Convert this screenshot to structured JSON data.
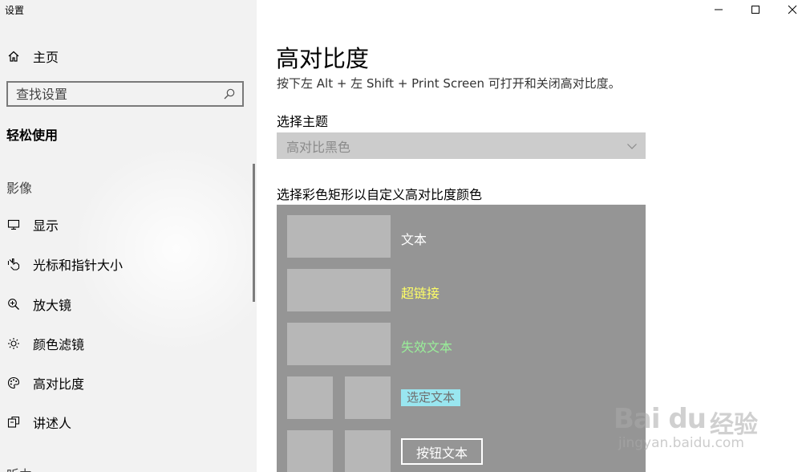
{
  "window": {
    "title": "设置",
    "controls": {
      "minimize": "minimize",
      "maximize": "maximize",
      "close": "close"
    }
  },
  "sidebar": {
    "home_label": "主页",
    "search_placeholder": "查找设置",
    "section_title": "轻松使用",
    "group_label": "影像",
    "items": [
      {
        "label": "显示",
        "icon": "monitor-icon"
      },
      {
        "label": "光标和指针大小",
        "icon": "pointer-icon"
      },
      {
        "label": "放大镜",
        "icon": "magnifier-icon"
      },
      {
        "label": "颜色滤镜",
        "icon": "sun-icon"
      },
      {
        "label": "高对比度",
        "icon": "palette-icon"
      },
      {
        "label": "讲述人",
        "icon": "narrator-icon"
      }
    ],
    "more_label": "听力"
  },
  "main": {
    "title": "高对比度",
    "hint": "按下左 Alt + 左 Shift + Print Screen 可打开和关闭高对比度。",
    "theme_label": "选择主题",
    "theme_selected": "高对比黑色",
    "color_label": "选择彩色矩形以自定义高对比度颜色",
    "swatches": {
      "text": "文本",
      "hyperlink": "超链接",
      "disabled_text": "失效文本",
      "selected_text": "选定文本",
      "button_text": "按钮文本"
    }
  },
  "colors": {
    "sidebar_bg": "#f2f2f2",
    "panel_bg": "#959595",
    "swatch_bg": "#b7b7b7",
    "hyperlink": "#ffff66",
    "disabled": "#99ee99",
    "selected_bg": "#99e6f0"
  },
  "watermark": {
    "brand": "Bai du",
    "cn": "经验",
    "url": "jingyan.baidu.com"
  }
}
